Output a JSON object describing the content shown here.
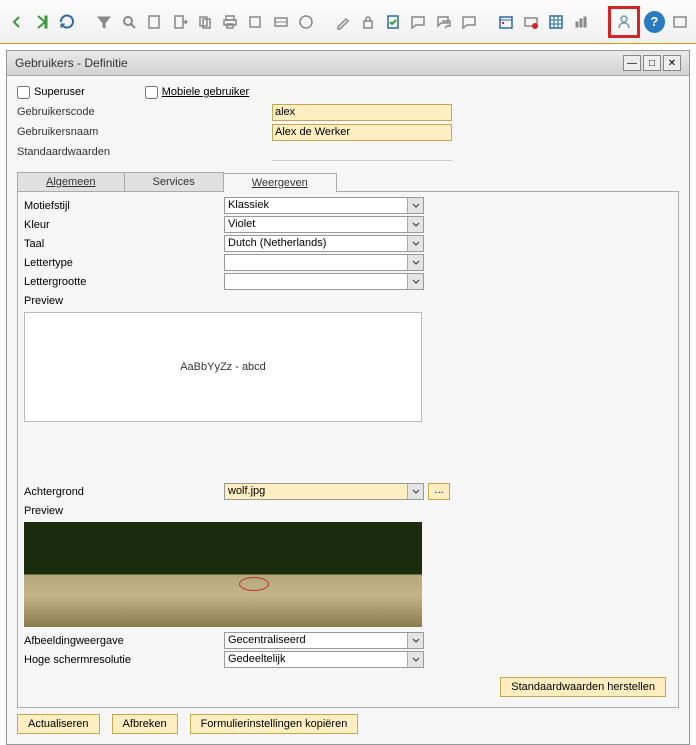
{
  "window": {
    "title": "Gebruikers - Definitie"
  },
  "topchecks": {
    "superuser": "Superuser",
    "mobile": "Mobiele gebruiker"
  },
  "fields": {
    "usercode_label": "Gebruikerscode",
    "usercode_value": "alex",
    "username_label": "Gebruikersnaam",
    "username_value": "Alex de Werker",
    "defaults_label": "Standaardwaarden",
    "defaults_value": ""
  },
  "tabs": {
    "general": "Algemeen",
    "services": "Services",
    "display": "Weergeven"
  },
  "display": {
    "motif_label": "Motiefstijl",
    "motif_value": "Klassiek",
    "color_label": "Kleur",
    "color_value": "Violet",
    "lang_label": "Taal",
    "lang_value": "Dutch (Netherlands)",
    "font_label": "Lettertype",
    "font_value": "",
    "fontsize_label": "Lettergrootte",
    "fontsize_value": "",
    "preview_label": "Preview",
    "preview_text": "AaBbYyZz - abcd",
    "bg_label": "Achtergrond",
    "bg_value": "wolf.jpg",
    "preview2_label": "Preview",
    "imgmode_label": "Afbeeldingweergave",
    "imgmode_value": "Gecentraliseerd",
    "hires_label": "Hoge schermresolutie",
    "hires_value": "Gedeeltelijk"
  },
  "buttons": {
    "restore": "Standaardwaarden herstellen",
    "update": "Actualiseren",
    "cancel": "Afbreken",
    "copy": "Formulierinstellingen kopiëren"
  }
}
